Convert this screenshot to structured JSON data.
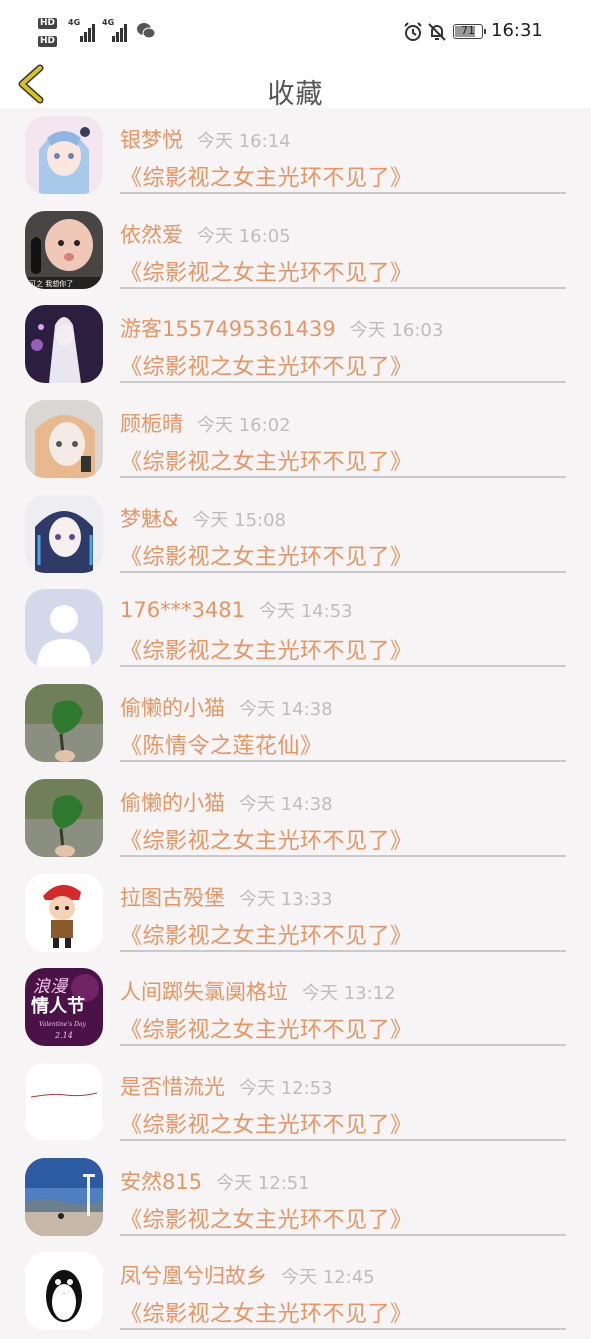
{
  "status_bar": {
    "sim1": "HD",
    "sim2": "HD",
    "network1": "4G",
    "network2": "4G",
    "battery": "71",
    "time": "16:31"
  },
  "header": {
    "title": "收藏"
  },
  "items": [
    {
      "user": "银梦悦",
      "time": "今天 16:14",
      "book": "《综影视之女主光环不见了》"
    },
    {
      "user": "依然爱",
      "time": "今天 16:05",
      "book": "《综影视之女主光环不见了》"
    },
    {
      "user": "游客1557495361439",
      "time": "今天 16:03",
      "book": "《综影视之女主光环不见了》"
    },
    {
      "user": "顾栀晴",
      "time": "今天 16:02",
      "book": "《综影视之女主光环不见了》"
    },
    {
      "user": "梦魅&",
      "time": "今天 15:08",
      "book": "《综影视之女主光环不见了》"
    },
    {
      "user": "176***3481",
      "time": "今天 14:53",
      "book": "《综影视之女主光环不见了》"
    },
    {
      "user": "偷懒的小猫",
      "time": "今天 14:38",
      "book": "《陈情令之莲花仙》"
    },
    {
      "user": "偷懒的小猫",
      "time": "今天 14:38",
      "book": "《综影视之女主光环不见了》"
    },
    {
      "user": "拉图古殁堡",
      "time": "今天 13:33",
      "book": "《综影视之女主光环不见了》"
    },
    {
      "user": "人间踯失氯阒格垃",
      "time": "今天 13:12",
      "book": "《综影视之女主光环不见了》"
    },
    {
      "user": "是否惜流光",
      "time": "今天 12:53",
      "book": "《综影视之女主光环不见了》"
    },
    {
      "user": "安然815",
      "time": "今天 12:51",
      "book": "《综影视之女主光环不见了》"
    },
    {
      "user": "凤兮凰兮归故乡",
      "time": "今天 12:45",
      "book": "《综影视之女主光环不见了》"
    }
  ],
  "avatar_text": {
    "item2": "可之 我想你了",
    "item10_line1": "浪漫",
    "item10_line2": "情人节",
    "item10_line3": "Valentine's Day",
    "item10_line4": "2.14"
  },
  "colors": {
    "accent": "#e79563",
    "back_arrow": "#d9c21b",
    "time_gray": "#bdbdbd",
    "divider": "#c9c9c9"
  },
  "icons": {
    "back": "chevron-left-icon",
    "wechat": "wechat-icon",
    "alarm": "alarm-icon",
    "mute": "bell-off-icon"
  }
}
